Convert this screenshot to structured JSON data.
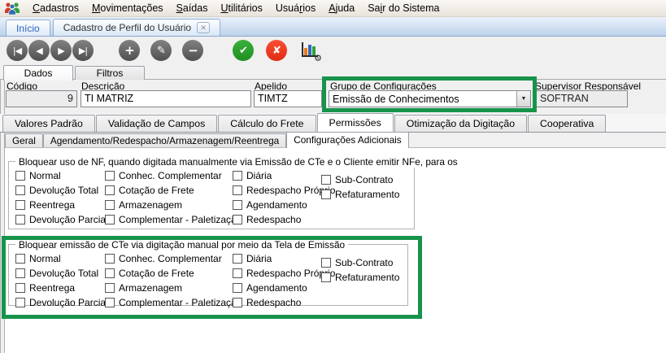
{
  "window_title": "Cadastro de Perfil do Usuário",
  "menu_bar": {
    "items": [
      {
        "pre": "",
        "key": "C",
        "post": "adastros"
      },
      {
        "pre": "",
        "key": "M",
        "post": "ovimentações"
      },
      {
        "pre": "",
        "key": "S",
        "post": "aídas"
      },
      {
        "pre": "",
        "key": "U",
        "post": "tilitários"
      },
      {
        "pre": "Usuá",
        "key": "r",
        "post": "ios"
      },
      {
        "pre": "",
        "key": "A",
        "post": "juda"
      },
      {
        "pre": "Sa",
        "key": "i",
        "post": "r do Sistema"
      }
    ]
  },
  "tab_strip": {
    "tabs": [
      {
        "label": "Início",
        "closable": false
      },
      {
        "label": "Cadastro de Perfil do Usuário",
        "closable": true
      }
    ],
    "active": "Cadastro de Perfil do Usuário",
    "close_glyph": "✕"
  },
  "toolbar": {
    "buttons": [
      {
        "name": "first-record",
        "glyph": "|◀"
      },
      {
        "name": "prior-record",
        "glyph": "◀"
      },
      {
        "name": "next-record",
        "glyph": "▶"
      },
      {
        "name": "last-record",
        "glyph": "▶|"
      },
      {
        "name": "insert-record",
        "glyph": "+"
      },
      {
        "name": "edit-record",
        "glyph": "✎"
      },
      {
        "name": "delete-record",
        "glyph": "−"
      },
      {
        "name": "confirm",
        "glyph": "✔"
      },
      {
        "name": "cancel",
        "glyph": "✘"
      },
      {
        "name": "chart-settings",
        "glyph": "⚙"
      }
    ]
  },
  "page_tabs": {
    "items": [
      "Dados",
      "Filtros"
    ],
    "selected": "Dados"
  },
  "form": {
    "codigo": {
      "label": "Código",
      "value": "9",
      "readonly": true
    },
    "descricao": {
      "label": "Descrição",
      "value": "TI MATRIZ",
      "readonly": false
    },
    "apelido": {
      "label": "Apelido",
      "value": "TIMTZ",
      "readonly": false
    },
    "grupo": {
      "label": "Grupo de Configurações",
      "value": "Emissão de Conhecimentos",
      "type": "dropdown",
      "arrow": "▼"
    },
    "supervisor": {
      "label": "Supervisor Responsável",
      "value": "SOFTRAN",
      "readonly": true
    }
  },
  "main_tabs": {
    "items": [
      "Valores Padrão",
      "Validação de Campos",
      "Cálculo do Frete",
      "Permissões",
      "Otimização da Digitação",
      "Cooperativa"
    ],
    "selected": "Permissões"
  },
  "sub_tabs": {
    "items": [
      "Geral",
      "Agendamento/Redespacho/Armazenagem/Reentrega",
      "Configurações Adicionais"
    ],
    "selected": "Configurações Adicionais"
  },
  "groups": [
    {
      "title": "Bloquear uso de NF, quando digitada manualmente via Emissão de CTe e o Cliente emitir NFe, para os",
      "highlighted": false,
      "all_unchecked": true,
      "columns": [
        [
          "Normal",
          "Devolução Total",
          "Reentrega",
          "Devolução Parcial"
        ],
        [
          "Conhec. Complementar",
          "Cotação de Frete",
          "Armazenagem",
          "Complementar - Paletização"
        ],
        [
          "Diária",
          "Redespacho Próprio",
          "Agendamento",
          "Redespacho"
        ],
        [
          "Sub-Contrato",
          "Refaturamento"
        ]
      ]
    },
    {
      "title": "Bloquear emissão de CTe via digitação manual por meio da Tela de Emissão",
      "highlighted": true,
      "all_unchecked": true,
      "columns": [
        [
          "Normal",
          "Devolução Total",
          "Reentrega",
          "Devolução Parcial"
        ],
        [
          "Conhec. Complementar",
          "Cotação de Frete",
          "Armazenagem",
          "Complementar - Paletização"
        ],
        [
          "Diária",
          "Redespacho Próprio",
          "Agendamento",
          "Redespacho"
        ],
        [
          "Sub-Contrato",
          "Refaturamento"
        ]
      ]
    }
  ],
  "colors": {
    "highlight_green": "#17934b",
    "confirm_green": "#2aa12b",
    "cancel_red": "#ef3b22",
    "chart_orange": "#e8791e",
    "chart_blue": "#2e6db4",
    "chart_green": "#2f9e3f"
  }
}
